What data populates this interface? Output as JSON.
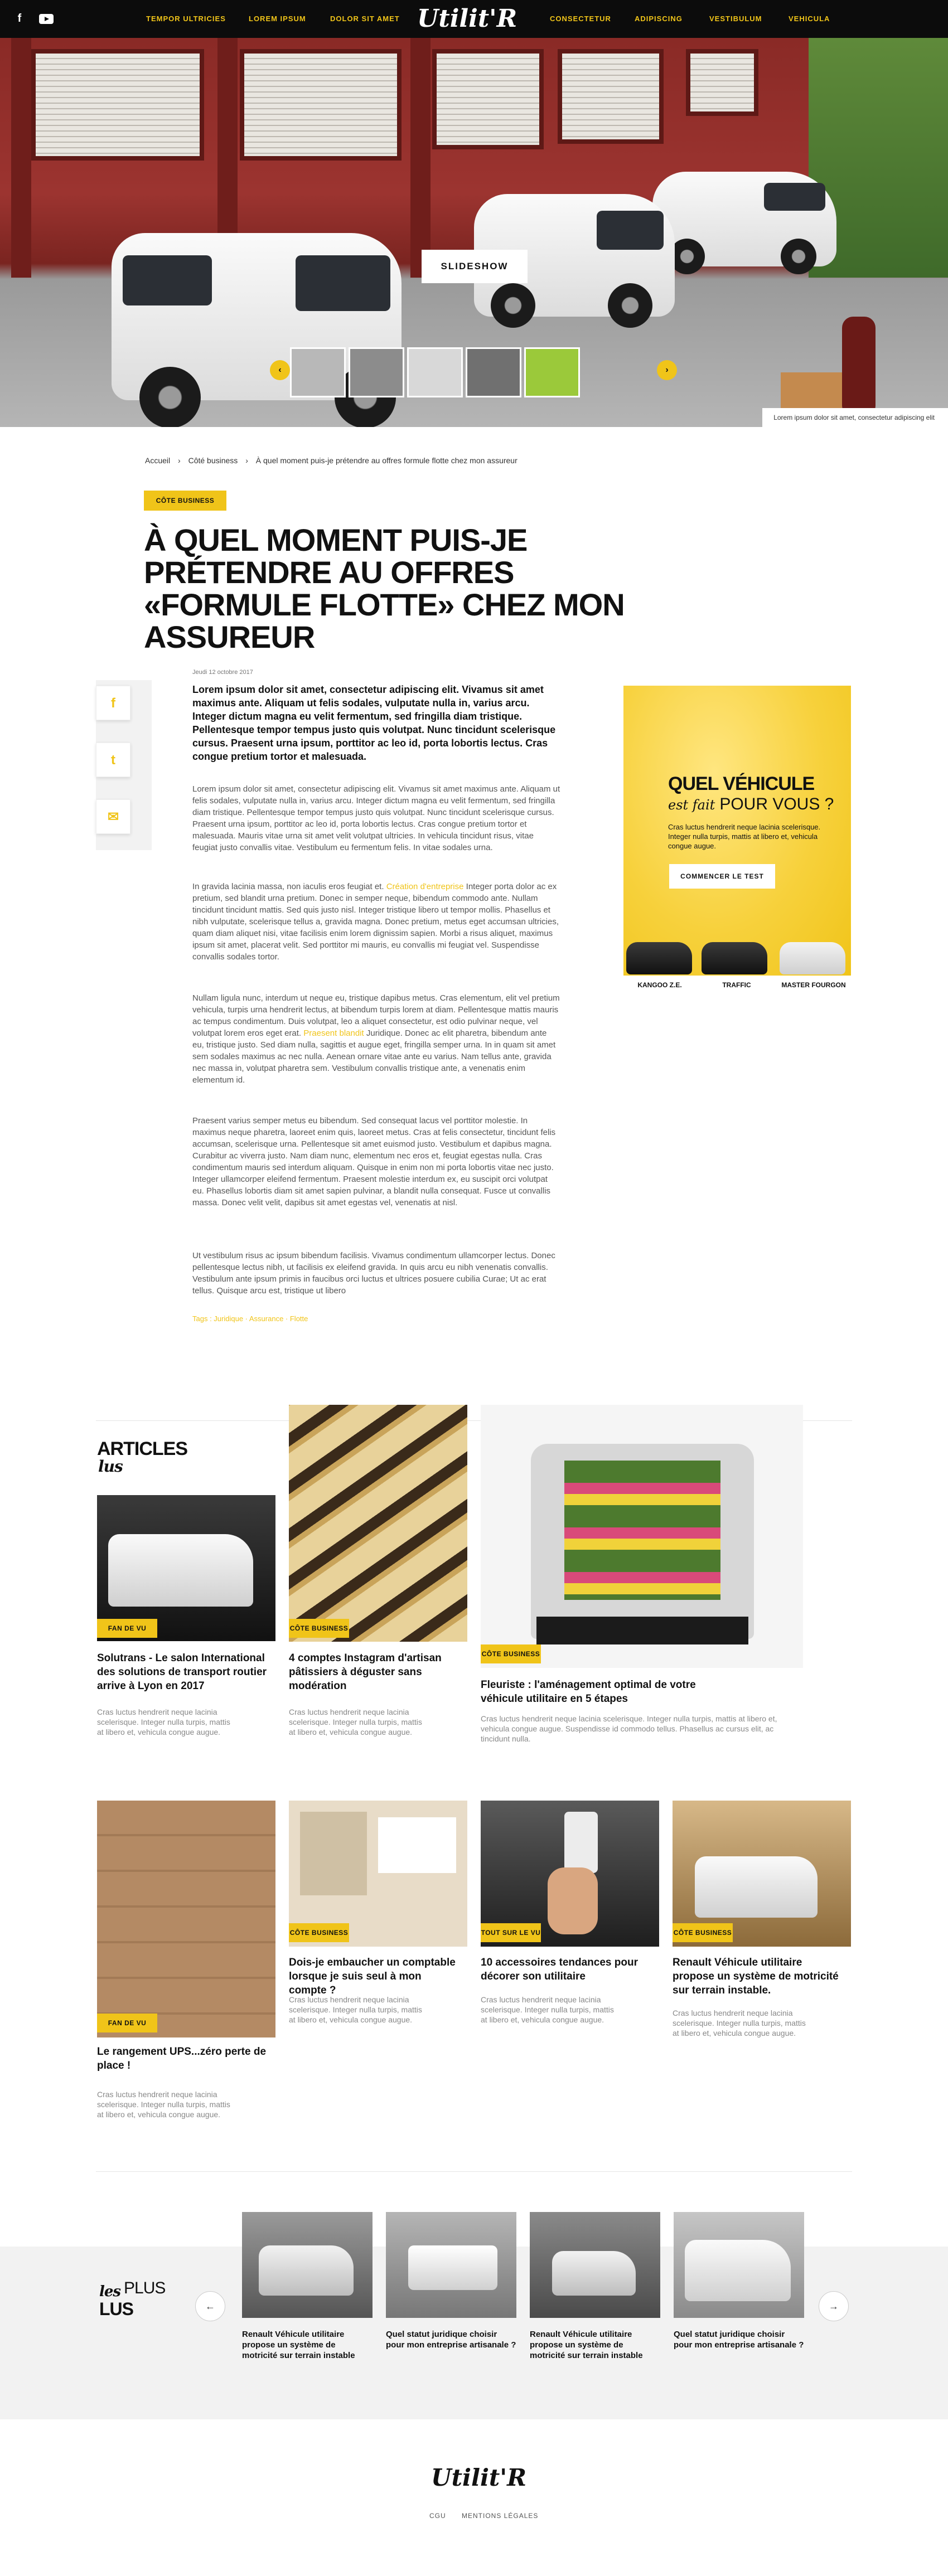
{
  "header": {
    "logo": "Utilit'R",
    "nav_left": [
      "TEMPOR ULTRICIES",
      "LOREM IPSUM",
      "DOLOR SIT AMET"
    ],
    "nav_right": [
      "CONSECTETUR",
      "ADIPISCING",
      "VESTIBULUM",
      "VEHICULA"
    ],
    "social": [
      "facebook-icon",
      "youtube-icon"
    ]
  },
  "hero": {
    "slideshow_label": "SLIDESHOW",
    "caption": "Lorem ipsum dolor sit amet, consectetur adipiscing elit"
  },
  "breadcrumb": {
    "items": [
      "Accueil",
      "Côté business",
      "À quel moment puis-je prétendre au offres formule flotte chez mon assureur"
    ],
    "separator": "›"
  },
  "article": {
    "category": "CÔTE BUSINESS",
    "title": "À QUEL MOMENT PUIS-JE PRÉTENDRE AU OFFRES «FORMULE FLOTTE» CHEZ MON ASSUREUR",
    "date": "Jeudi 12 octobre 2017",
    "lead": "Lorem ipsum dolor sit amet, consectetur adipiscing elit. Vivamus sit amet maximus ante. Aliquam ut felis sodales, vulputate nulla in, varius arcu. Integer dictum magna eu velit fermentum, sed fringilla diam tristique. Pellentesque tempor tempus justo quis volutpat. Nunc tincidunt scelerisque cursus. Praesent urna ipsum, porttitor ac leo id, porta lobortis lectus. Cras congue pretium tortor et malesuada.",
    "p1": "Lorem ipsum dolor sit amet, consectetur adipiscing elit. Vivamus sit amet maximus ante. Aliquam ut felis sodales, vulputate nulla in, varius arcu. Integer dictum magna eu velit fermentum, sed fringilla diam tristique. Pellentesque tempor tempus justo quis volutpat. Nunc tincidunt scelerisque cursus. Praesent urna ipsum, porttitor ac leo id, porta lobortis lectus. Cras congue pretium tortor et malesuada. Mauris vitae urna sit amet velit volutpat ultricies. In vehicula tincidunt risus, vitae feugiat justo convallis vitae. Vestibulum eu fermentum felis. In vitae sodales urna.",
    "p2_before": "In gravida lacinia massa, non iaculis eros feugiat et. ",
    "p2_link": "Création d'entreprise",
    "p2_after": " Integer porta dolor ac ex pretium, sed blandit urna pretium. Donec in semper neque, bibendum commodo ante. Nullam tincidunt tincidunt mattis. Sed quis justo nisl. Integer tristique libero ut tempor mollis. Phasellus et nibh vulputate, scelerisque tellus a, gravida magna. Donec pretium, metus eget accumsan ultricies, quam diam aliquet nisi, vitae facilisis enim lorem dignissim sapien. Morbi a risus aliquet, maximus ipsum sit amet, placerat velit. Sed porttitor mi mauris, eu convallis mi feugiat vel. Suspendisse convallis sodales tortor.",
    "p3_before": "Nullam ligula nunc, interdum ut neque eu, tristique dapibus metus. Cras elementum, elit vel pretium vehicula, turpis urna hendrerit lectus, at bibendum turpis lorem at diam. Pellentesque mattis mauris ac tempus condimentum. Duis volutpat, leo a aliquet consectetur, est odio pulvinar neque, vel volutpat lorem eros eget erat. ",
    "p3_link": "Praesent blandit",
    "p3_after": " Juridique. Donec ac elit pharetra, bibendum ante eu, tristique justo. Sed diam nulla, sagittis et augue eget, fringilla semper urna. In in quam sit amet sem sodales maximus ac nec nulla. Aenean ornare vitae ante eu varius. Nam tellus ante, gravida nec massa in, volutpat pharetra sem. Vestibulum convallis tristique ante, a venenatis enim elementum id.",
    "p4": "Praesent varius semper metus eu bibendum. Sed consequat lacus vel porttitor molestie. In maximus neque pharetra, laoreet enim quis, laoreet metus. Cras at felis consectetur, tincidunt felis accumsan, scelerisque urna. Pellentesque sit amet euismod justo. Vestibulum et dapibus magna. Curabitur ac viverra justo. Nam diam nunc, elementum nec eros et, feugiat egestas nulla. Cras condimentum mauris sed interdum aliquam. Quisque in enim non mi porta lobortis vitae nec justo. Integer ullamcorper eleifend fermentum. Praesent molestie interdum ex, eu suscipit orci volutpat eu. Phasellus lobortis diam sit amet sapien pulvinar, a blandit nulla consequat. Fusce ut convallis massa. Donec velit velit, dapibus sit amet egestas vel, venenatis at nisl.",
    "p5": "Ut vestibulum risus ac ipsum bibendum facilisis. Vivamus condimentum ullamcorper lectus. Donec pellentesque lectus nibh, ut facilisis ex eleifend gravida. In quis arcu eu nibh venenatis convallis. Vestibulum ante ipsum primis in faucibus orci luctus et ultrices posuere cubilia Curae; Ut ac erat tellus. Quisque arcu est, tristique ut libero",
    "tags": "Tags : Juridique · Assurance · Flotte"
  },
  "ad": {
    "title": "QUEL VÉHICULE",
    "script": "est fait",
    "sub": "POUR VOUS ?",
    "text": "Cras luctus hendrerit neque lacinia scelerisque. Integer nulla turpis, mattis at libero et, vehicula congue augue.",
    "button": "COMMENCER LE TEST",
    "vans": [
      "KANGOO Z.E.",
      "TRAFFIC",
      "MASTER FOURGON"
    ]
  },
  "articles_lus": {
    "title_big": "ARTICLES",
    "title_script": "lus",
    "cards": [
      {
        "badge": "FAN DE VU",
        "title": "Solutrans  - Le salon International des solutions de transport routier arrive à Lyon en 2017",
        "desc": "Cras luctus hendrerit neque lacinia scelerisque. Integer nulla turpis, mattis at libero et, vehicula congue augue."
      },
      {
        "badge": "CÔTE BUSINESS",
        "title": "4 comptes Instagram d'artisan pâtissiers à déguster sans modération",
        "desc": "Cras luctus hendrerit neque lacinia scelerisque. Integer nulla turpis, mattis at libero et, vehicula congue augue."
      },
      {
        "badge": "CÔTE BUSINESS",
        "title": "Fleuriste : l'aménagement optimal de votre véhicule utilitaire en 5 étapes",
        "desc": "Cras luctus hendrerit neque lacinia scelerisque. Integer nulla turpis, mattis at libero et, vehicula congue augue. Suspendisse id commodo tellus. Phasellus ac cursus elit, ac tincidunt nulla."
      },
      {
        "badge": "FAN DE VU",
        "title": "Le rangement UPS...zéro perte de place !",
        "desc": "Cras luctus hendrerit neque lacinia scelerisque. Integer nulla turpis, mattis at libero et, vehicula congue augue."
      },
      {
        "badge": "CÔTE BUSINESS",
        "title": "Dois-je embaucher un comptable lorsque je suis seul à mon compte ?",
        "desc": "Cras luctus hendrerit neque lacinia scelerisque. Integer nulla turpis, mattis at libero et, vehicula congue augue."
      },
      {
        "badge": "TOUT SUR LE VU",
        "title": "10 accessoires tendances pour décorer son utilitaire",
        "desc": "Cras luctus hendrerit neque lacinia scelerisque. Integer nulla turpis, mattis at libero et, vehicula congue augue."
      },
      {
        "badge": "CÔTE BUSINESS",
        "title": "Renault Véhicule utilitaire propose un système de motricité sur terrain instable.",
        "desc": "Cras luctus hendrerit neque lacinia scelerisque. Integer nulla turpis, mattis at libero et, vehicula congue augue."
      }
    ]
  },
  "plus_lus": {
    "script": "les",
    "big1": "PLUS",
    "big2": "LUS",
    "prev": "←",
    "next": "→",
    "cards": [
      {
        "title": "Renault Véhicule utilitaire propose un système de motricité sur terrain instable"
      },
      {
        "title": "Quel statut juridique choisir pour mon entreprise artisanale ?"
      },
      {
        "title": "Renault Véhicule utilitaire propose un système de motricité sur terrain instable"
      },
      {
        "title": "Quel statut juridique choisir pour mon entreprise artisanale ?"
      }
    ]
  },
  "footer": {
    "logo": "Utilit'R",
    "links": [
      "CGU",
      "MENTIONS LÉGALES"
    ]
  }
}
